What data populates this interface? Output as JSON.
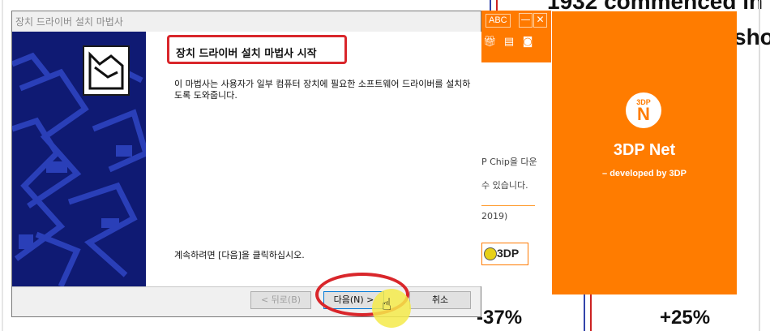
{
  "wizard": {
    "title": "장치 드라이버 설치 마법사",
    "heading": "장치 드라이버 설치 마법사 시작",
    "description": "이 마법사는 사용자가 일부 컴퓨터 장치에 필요한 소프트웨어 드라이버를 설치하도록 도와줍니다.",
    "continue_text": "계속하려면 [다음]을 클릭하십시오.",
    "buttons": {
      "back": "< 뒤로(B)",
      "next": "다음(N) >",
      "cancel": "취소"
    }
  },
  "chip_window": {
    "abc_label": "ABC",
    "minimize_label": "—",
    "close_label": "✕",
    "text_line1": "P Chip을 다운",
    "text_line2": "수 있습니다.",
    "text_line3": "2019)",
    "logo_text": "3DP"
  },
  "net_panel": {
    "badge_top": "3DP",
    "badge_letter": "N",
    "title": "3DP Net",
    "subtitle": "– developed by 3DP"
  },
  "background": {
    "headline": "1932 commenced in",
    "headline_line2": "sho",
    "pct1": "-37%",
    "pct2": "+25%"
  },
  "colors": {
    "accent_orange": "#ff7c00",
    "annotation_red": "#d9262b",
    "wizard_art_blue": "#0f1a73"
  }
}
